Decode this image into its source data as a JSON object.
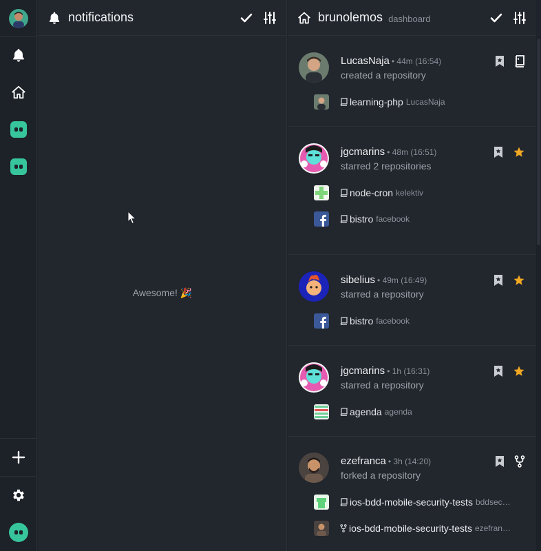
{
  "notifications": {
    "title": "notifications",
    "empty_message": "Awesome! 🎉"
  },
  "dashboard": {
    "title": "brunolemos",
    "subtitle": "dashboard",
    "events": [
      {
        "user": "LucasNaja",
        "time": "• 44m (16:54)",
        "action": "created a repository",
        "icon": "repo-icon",
        "repos": [
          {
            "name": "learning-php",
            "owner": "LucasNaja",
            "kind": "repo"
          }
        ]
      },
      {
        "user": "jgcmarins",
        "time": "• 48m (16:51)",
        "action": "starred 2 repositories",
        "icon": "star-icon",
        "repos": [
          {
            "name": "node-cron",
            "owner": "kelektiv",
            "kind": "repo"
          },
          {
            "name": "bistro",
            "owner": "facebook",
            "kind": "repo"
          }
        ]
      },
      {
        "user": "sibelius",
        "time": "• 49m (16:49)",
        "action": "starred a repository",
        "icon": "star-icon",
        "repos": [
          {
            "name": "bistro",
            "owner": "facebook",
            "kind": "repo"
          }
        ]
      },
      {
        "user": "jgcmarins",
        "time": "• 1h (16:31)",
        "action": "starred a repository",
        "icon": "star-icon",
        "repos": [
          {
            "name": "agenda",
            "owner": "agenda",
            "kind": "repo"
          }
        ]
      },
      {
        "user": "ezefranca",
        "time": "• 3h (14:20)",
        "action": "forked a repository",
        "icon": "fork-icon",
        "repos": [
          {
            "name": "ios-bdd-mobile-security-tests",
            "owner": "bddsec…",
            "kind": "repo"
          },
          {
            "name": "ios-bdd-mobile-security-tests",
            "owner": "ezefran…",
            "kind": "fork"
          }
        ]
      }
    ]
  },
  "colors": {
    "background": "#22262d",
    "sidebar": "#1d2128",
    "accent": "#37c59c",
    "star": "#f0a722",
    "muted_text": "#8a919b"
  }
}
